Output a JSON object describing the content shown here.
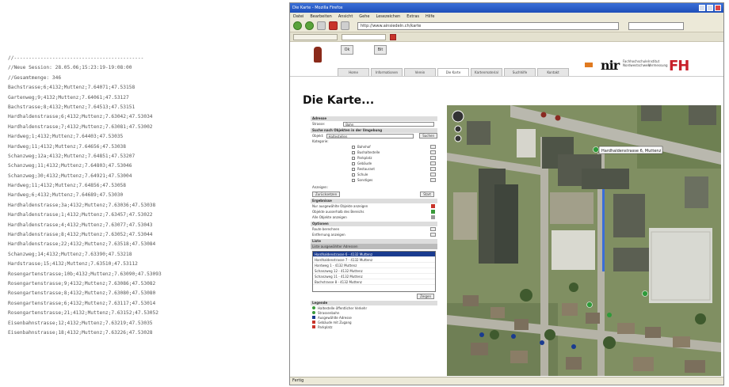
{
  "log": {
    "lines": [
      "//--------------------------------------------",
      "//Neue Session: 28.05.06;15:23:19-19:08:00",
      "//Gesamtmenge: 346",
      "Bachstrasse;6;4132;Muttenz;7.64071;47.53158",
      "Gartenweg;9;4132;Muttenz;7.64061;47.53127",
      "Bachstrasse;8;4132;Muttenz;7.64513;47.53151",
      "Hardhaldenstrasse;6;4132;Muttenz;7.63042;47.53034",
      "Hardhaldenstrasse;7;4132;Muttenz;7.63081;47.53002",
      "Hardweg;1;4132;Muttenz;7.64403;47.53035",
      "Hardweg;11;4132;Muttenz;7.64656;47.53038",
      "Schanzweg;12a;4132;Muttenz;7.64851;47.53207",
      "Schanzweg;11;4132;Muttenz;7.64803;47.53046",
      "Schanzweg;30;4132;Muttenz;7.64921;47.53004",
      "Hardweg;11;4132;Muttenz;7.64856;47.53058",
      "Hardweg;6;4132;Muttenz;7.64689;47.53030",
      "Hardhaldenstrasse;3a;4132;Muttenz;7.63036;47.53038",
      "Hardhaldenstrasse;1;4132;Muttenz;7.63457;47.53022",
      "Hardhaldenstrasse;4;4132;Muttenz;7.63077;47.53043",
      "Hardhaldenstrasse;8;4132;Muttenz;7.63052;47.53044",
      "Hardhaldenstrasse;22;4132;Muttenz;7.63518;47.53084",
      "Schanzweg;14;4132;Muttenz;7.63390;47.53218",
      "Hardstrasse;15;4132;Muttenz;7.63510;47.53112",
      "Rosengartenstrasse;10b;4132;Muttenz;7.63090;47.53093",
      "Rosengartenstrasse;9;4132;Muttenz;7.63086;47.53082",
      "Rosengartenstrasse;8;4132;Muttenz;7.63080;47.53080",
      "Rosengartenstrasse;6;4132;Muttenz;7.63117;47.53014",
      "Rosengartenstrasse;21;4132;Muttenz;7.63152;47.53052",
      "Eisenbahnstrasse;12;4132;Muttenz;7.63219;47.53035",
      "Eisenbahnstrasse;18;4132;Muttenz;7.63226;47.53028"
    ]
  },
  "browser": {
    "window_title": "Die Karte - Mozilla Firefox",
    "menu": [
      "Datei",
      "Bearbeiten",
      "Ansicht",
      "Gehe",
      "Lesezeichen",
      "Extras",
      "Hilfe"
    ],
    "url": "http://www.ainsiedeln.ch/karte",
    "status": "Fertig"
  },
  "site": {
    "buttons": [
      "Ok",
      "Bit"
    ],
    "tabs": [
      "Home",
      "Informationen",
      "Verein",
      "Die Karte",
      "Kartenmaterial",
      "Suchhilfe",
      "Kontakt"
    ],
    "nir_logo": "nir",
    "nir_sub": "Fachhochschule Nordwestschweiz",
    "fh_logo": "FH",
    "fh_sub": "Institut Vermessung",
    "heading": "Die Karte..."
  },
  "panel": {
    "sec1": "Adresse",
    "strasse_label": "Strasse:",
    "strasse_value": "Bahn",
    "sec2": "Suche nach Objekten in der Umgebung",
    "objekt_label": "Objekt:",
    "objekt_value": "Haltestellen",
    "objekt_btn": "Suchen",
    "kategorie_label": "Kategorie:",
    "items": [
      "Bahnhof",
      "Bushaltestelle",
      "Parkplatz",
      "Gebäude",
      "Restaurant",
      "Schule",
      "Sonstiges"
    ],
    "anzeigen_label": "Anzeigen:",
    "btn_left": "Zurücksetzen",
    "btn_right": "Start",
    "sec3": "Ergebnisse",
    "results_opts": [
      "Nur ausgewählte Objekte anzeigen",
      "Objekte ausserhalb des Bereichs",
      "Alle Objekte anzeigen"
    ],
    "options_sec": "Optionen",
    "options": [
      "Route berechnen",
      "Entfernung anzeigen"
    ],
    "list_label": "Liste",
    "list_header": "Liste ausgewählter Adressen",
    "list_items": [
      "Hardhaldenstrasse 6 - 4132 Muttenz",
      "Hardhaldenstrasse 7 - 4132 Muttenz",
      "Hardweg 1 - 4132 Muttenz",
      "Schanzweg 12 - 4132 Muttenz",
      "Schanzweg 11 - 4132 Muttenz",
      "Bachstrasse 8 - 4132 Muttenz"
    ],
    "list_btn": "Zeigen",
    "legend_title": "Legende",
    "legend": [
      {
        "label": "Haltestelle öffentlicher Verkehr",
        "color": "#3a9a3a"
      },
      {
        "label": "Strassenbahn",
        "color": "#3a9a3a"
      },
      {
        "label": "Ausgewählte Adresse",
        "color": "#1a3b8f"
      },
      {
        "label": "Gebäude mit Zugang",
        "color": "#c8342a"
      },
      {
        "label": "Parkplatz",
        "color": "#c8342a"
      }
    ]
  },
  "map": {
    "tooltip": "Hardhaldenstrasse 6, Muttenz"
  }
}
